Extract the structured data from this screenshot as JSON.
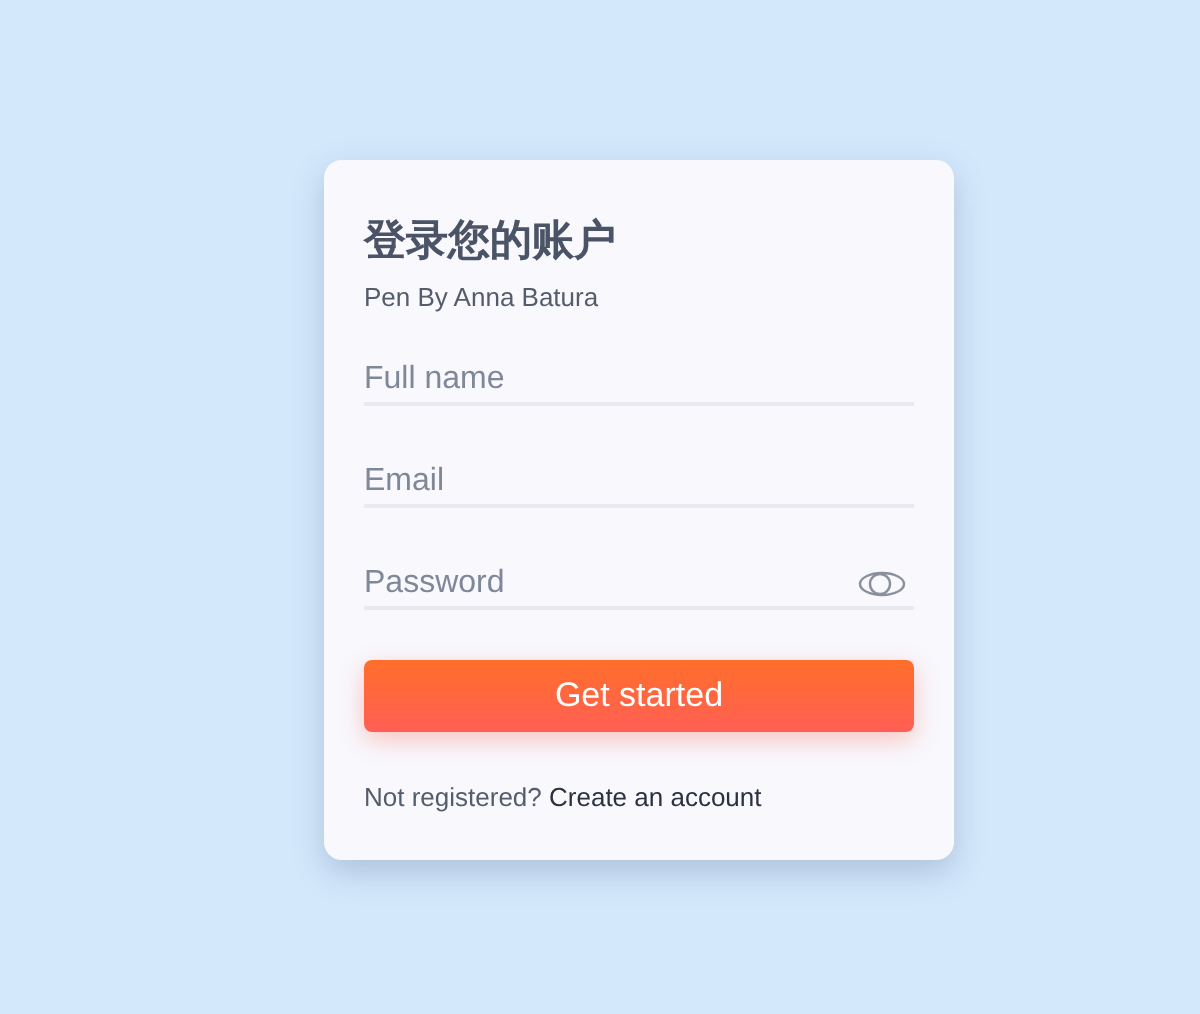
{
  "card": {
    "title": "登录您的账户",
    "subtitle": "Pen By Anna Batura"
  },
  "fields": [
    {
      "kind": "text",
      "placeholder": "Full name"
    },
    {
      "kind": "email",
      "placeholder": "Email"
    },
    {
      "kind": "password",
      "placeholder": "Password"
    }
  ],
  "submit": "Get started",
  "footer": {
    "text": "Not registered?",
    "link": "Create an account"
  }
}
